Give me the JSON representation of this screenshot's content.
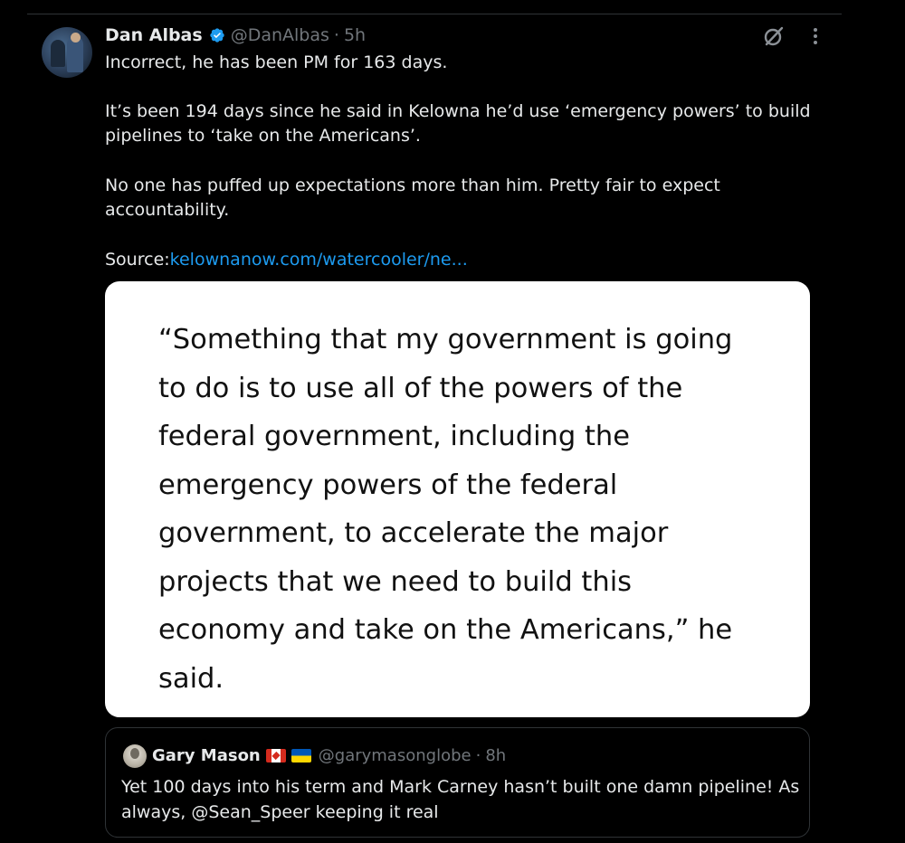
{
  "post": {
    "author_name": "Dan Albas",
    "handle": "@DanAlbas",
    "separator": "·",
    "time": "5h",
    "icons": {
      "verified": "verified-badge-icon",
      "grok": "grok-icon",
      "more": "more-options-icon"
    },
    "paragraphs": {
      "p1": "Incorrect, he has been PM for 163 days.",
      "p2_line1": "It’s been 194 days since he said in Kelowna he’d use ‘emergency powers’ to build",
      "p2_line2": "pipelines to ‘take on the Americans’.",
      "p3_line1": "No one has puffed up expectations more than him. Pretty fair to expect",
      "p3_line2": "accountability.",
      "source_label": "Source:",
      "source_link": "kelownanow.com/watercooler/ne..."
    },
    "image_quote": {
      "line1": "“Something that my government is going",
      "line2": "to do is to use all of the powers of the",
      "line3": "federal government, including the",
      "line4": "emergency powers of the federal",
      "line5": "government, to accelerate the major",
      "line6": "projects that we need to build this",
      "line7": "economy and take on the Americans,” he",
      "line8": "said."
    }
  },
  "quoted_post": {
    "author_name": "Gary Mason",
    "flags": [
      "canada-flag-icon",
      "ukraine-flag-icon"
    ],
    "handle": "@garymasonglobe",
    "separator": "·",
    "time": "8h",
    "text_line1": "Yet 100 days into his term and Mark Carney hasn’t built one damn pipeline! As",
    "text_line2": "always, @Sean_Speer keeping it real"
  },
  "colors": {
    "background": "#000000",
    "text": "#e7e9ea",
    "muted": "#71767b",
    "link": "#1d9bf0",
    "verified": "#1d9bf0",
    "border": "#2f3336"
  }
}
